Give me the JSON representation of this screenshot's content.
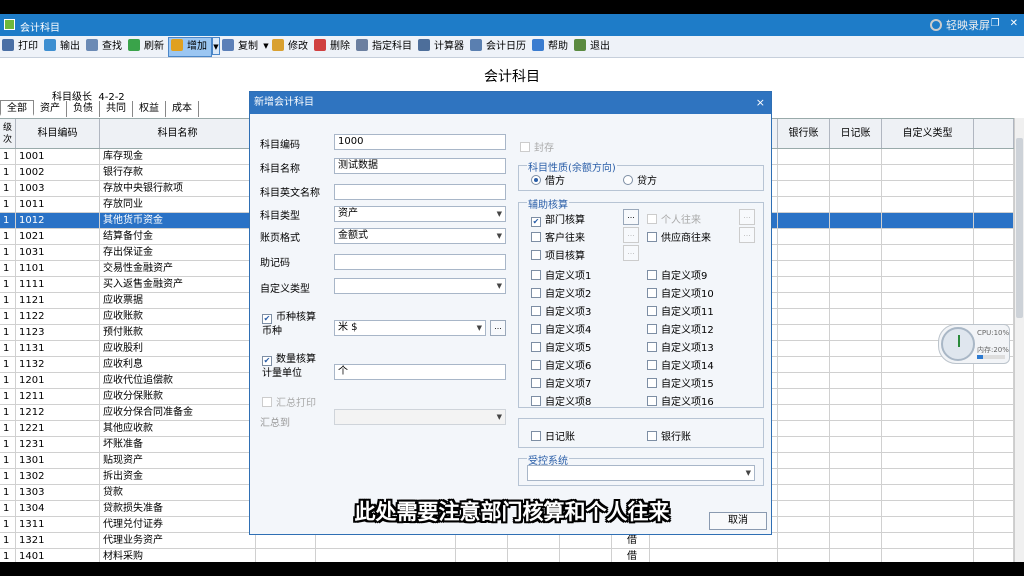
{
  "window": {
    "title": "会计科目",
    "watermark": "轻映录屏"
  },
  "toolbar": [
    {
      "label": "打印",
      "icon": "printer-icon",
      "color": "#4a6fa5"
    },
    {
      "label": "输出",
      "icon": "export-icon",
      "color": "#3d8fd1"
    },
    {
      "label": "查找",
      "icon": "find-icon",
      "color": "#6b8ab5"
    },
    {
      "label": "刷新",
      "icon": "refresh-icon",
      "color": "#3aa34a"
    },
    {
      "label": "增加",
      "icon": "add-icon",
      "color": "#e0a020",
      "selected": true
    },
    {
      "label": "复制",
      "icon": "copy-icon",
      "color": "#5b7fb8"
    },
    {
      "label": "修改",
      "icon": "edit-icon",
      "color": "#d9a030"
    },
    {
      "label": "删除",
      "icon": "delete-icon",
      "color": "#d04040"
    },
    {
      "label": "指定科目",
      "icon": "assign-icon",
      "color": "#6b7fa0"
    },
    {
      "label": "计算器",
      "icon": "calculator-icon",
      "color": "#4d6e9a"
    },
    {
      "label": "会计日历",
      "icon": "calendar-icon",
      "color": "#5a7fb0"
    },
    {
      "label": "帮助",
      "icon": "help-icon",
      "color": "#3a7cd0"
    },
    {
      "label": "退出",
      "icon": "exit-icon",
      "color": "#5a8a40"
    }
  ],
  "page": {
    "title": "会计科目",
    "level_label": "科目级长",
    "level_value": "4-2-2"
  },
  "tabs": [
    "全部",
    "资产",
    "负债",
    "共同",
    "权益",
    "成本"
  ],
  "table": {
    "headers": [
      "级次",
      "科目编码",
      "科目名称",
      "",
      "",
      "",
      "",
      "",
      "",
      "",
      "银行账",
      "日记账",
      "自定义类型"
    ],
    "rows": [
      {
        "level": "1",
        "code": "1001",
        "name": "库存现金",
        "dir": ""
      },
      {
        "level": "1",
        "code": "1002",
        "name": "银行存款",
        "dir": ""
      },
      {
        "level": "1",
        "code": "1003",
        "name": "存放中央银行款项",
        "dir": ""
      },
      {
        "level": "1",
        "code": "1011",
        "name": "存放同业",
        "dir": ""
      },
      {
        "level": "1",
        "code": "1012",
        "name": "其他货币资金",
        "dir": "",
        "selected": true
      },
      {
        "level": "1",
        "code": "1021",
        "name": "结算备付金",
        "dir": ""
      },
      {
        "level": "1",
        "code": "1031",
        "name": "存出保证金",
        "dir": ""
      },
      {
        "level": "1",
        "code": "1101",
        "name": "交易性金融资产",
        "dir": ""
      },
      {
        "level": "1",
        "code": "1111",
        "name": "买入返售金融资产",
        "dir": ""
      },
      {
        "level": "1",
        "code": "1121",
        "name": "应收票据",
        "dir": ""
      },
      {
        "level": "1",
        "code": "1122",
        "name": "应收账款",
        "dir": ""
      },
      {
        "level": "1",
        "code": "1123",
        "name": "预付账款",
        "dir": ""
      },
      {
        "level": "1",
        "code": "1131",
        "name": "应收股利",
        "dir": ""
      },
      {
        "level": "1",
        "code": "1132",
        "name": "应收利息",
        "dir": ""
      },
      {
        "level": "1",
        "code": "1201",
        "name": "应收代位追偿款",
        "dir": ""
      },
      {
        "level": "1",
        "code": "1211",
        "name": "应收分保账款",
        "dir": ""
      },
      {
        "level": "1",
        "code": "1212",
        "name": "应收分保合同准备金",
        "dir": ""
      },
      {
        "level": "1",
        "code": "1221",
        "name": "其他应收款",
        "dir": ""
      },
      {
        "level": "1",
        "code": "1231",
        "name": "坏账准备",
        "dir": ""
      },
      {
        "level": "1",
        "code": "1301",
        "name": "贴现资产",
        "dir": ""
      },
      {
        "level": "1",
        "code": "1302",
        "name": "拆出资金",
        "dir": ""
      },
      {
        "level": "1",
        "code": "1303",
        "name": "贷款",
        "dir": ""
      },
      {
        "level": "1",
        "code": "1304",
        "name": "贷款损失准备",
        "dir": ""
      },
      {
        "level": "1",
        "code": "1311",
        "name": "代理兑付证券",
        "dir": ""
      },
      {
        "level": "1",
        "code": "1321",
        "name": "代理业务资产",
        "dir": "借"
      },
      {
        "level": "1",
        "code": "1401",
        "name": "材料采购",
        "dir": "借"
      }
    ]
  },
  "dialog": {
    "title": "新增会计科目",
    "close": "×",
    "fields": {
      "code_label": "科目编码",
      "code_value": "1000",
      "name_label": "科目名称",
      "name_value": "测试数据",
      "en_label": "科目英文名称",
      "en_value": "",
      "type_label": "科目类型",
      "type_value": "资产",
      "format_label": "账页格式",
      "format_value": "金额式",
      "mnemonic_label": "助记码",
      "mnemonic_value": "",
      "custom_type_label": "自定义类型",
      "custom_type_value": "",
      "currency_check": "币种核算",
      "currency_label": "币种",
      "currency_value": "米 $",
      "qty_check": "数量核算",
      "unit_label": "计量单位",
      "unit_value": "个",
      "summary_print": "汇总打印",
      "summary_to": "汇总到",
      "sealed": "封存"
    },
    "nature": {
      "title": "科目性质(余额方向)",
      "debit": "借方",
      "credit": "贷方"
    },
    "aux": {
      "title": "辅助核算",
      "dept": "部门核算",
      "personal": "个人往来",
      "customer": "客户往来",
      "supplier": "供应商往来",
      "project": "项目核算",
      "custom_left": [
        "自定义项1",
        "自定义项2",
        "自定义项3",
        "自定义项4",
        "自定义项5",
        "自定义项6",
        "自定义项7",
        "自定义项8"
      ],
      "custom_right": [
        "自定义项9",
        "自定义项10",
        "自定义项11",
        "自定义项12",
        "自定义项13",
        "自定义项14",
        "自定义项15",
        "自定义项16"
      ]
    },
    "journal": "日记账",
    "bank": "银行账",
    "control": {
      "title": "受控系统",
      "value": ""
    },
    "cancel": "取消"
  },
  "subtitle": "此处需要注意部门核算和个人往来",
  "gauge": {
    "cpu": "CPU:10%",
    "mem": "内存:20%",
    "mem_fraction": 0.2
  }
}
